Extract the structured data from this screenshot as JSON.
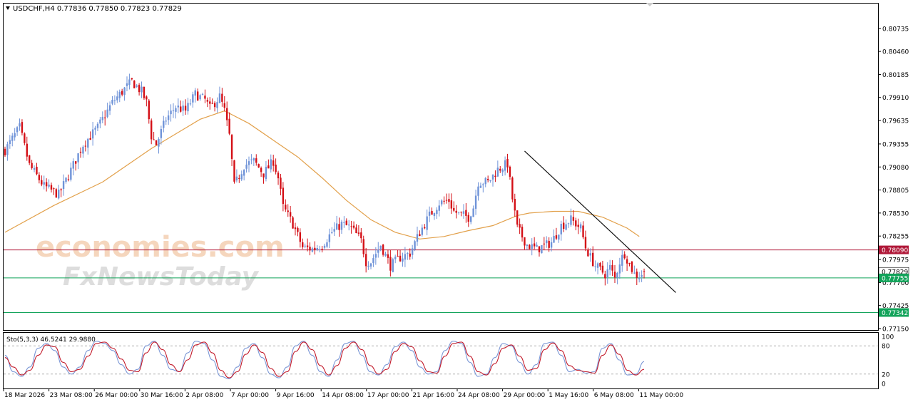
{
  "header": {
    "symbol_line": "USDCHF,H4  0.77836 0.77850 0.77823 0.77829"
  },
  "watermark": {
    "line1": "economies.com",
    "line2": "FxNewsToday"
  },
  "colors": {
    "bull": "#6f93d8",
    "bear": "#d40f16",
    "ma": "#e2a04a",
    "resistance": "#b01838",
    "support": "#12a35a",
    "trend": "#111111",
    "stoch_k": "#7b97d6",
    "stoch_d": "#c21b2b"
  },
  "chart_data": [
    {
      "type": "candlestick",
      "title": "USDCHF,H4",
      "ohlc_header": {
        "open": 0.77836,
        "high": 0.7785,
        "low": 0.77823,
        "close": 0.77829
      },
      "ylim": [
        0.7715,
        0.8081
      ],
      "y_ticks": [
        "0.80735",
        "0.80460",
        "0.80185",
        "0.79910",
        "0.79635",
        "0.79355",
        "0.79080",
        "0.78805",
        "0.78530",
        "0.78255",
        "0.77975",
        "0.77700",
        "0.77425",
        "0.77150"
      ],
      "x_ticks": [
        "18 Mar 2026",
        "23 Mar 08:00",
        "26 Mar 00:00",
        "30 Mar 16:00",
        "2 Apr 08:00",
        "7 Apr 00:00",
        "9 Apr 16:00",
        "14 Apr 08:00",
        "17 Apr 00:00",
        "21 Apr 16:00",
        "24 Apr 08:00",
        "29 Apr 00:00",
        "1 May 16:00",
        "6 May 08:00",
        "11 May 00:00"
      ],
      "close_path": [
        [
          0,
          0.7928
        ],
        [
          6,
          0.7955
        ],
        [
          10,
          0.791
        ],
        [
          16,
          0.7885
        ],
        [
          22,
          0.7875
        ],
        [
          26,
          0.7898
        ],
        [
          32,
          0.7935
        ],
        [
          38,
          0.7955
        ],
        [
          44,
          0.7985
        ],
        [
          48,
          0.7998
        ],
        [
          52,
          0.801
        ],
        [
          56,
          0.7998
        ],
        [
          58,
          0.7985
        ],
        [
          60,
          0.7945
        ],
        [
          62,
          0.7935
        ],
        [
          66,
          0.7965
        ],
        [
          70,
          0.798
        ],
        [
          74,
          0.7975
        ],
        [
          78,
          0.7995
        ],
        [
          82,
          0.7988
        ],
        [
          84,
          0.7978
        ],
        [
          88,
          0.7992
        ],
        [
          90,
          0.7975
        ],
        [
          92,
          0.7945
        ],
        [
          94,
          0.7885
        ],
        [
          98,
          0.791
        ],
        [
          102,
          0.7915
        ],
        [
          106,
          0.79
        ],
        [
          110,
          0.7915
        ],
        [
          112,
          0.7895
        ],
        [
          114,
          0.786
        ],
        [
          118,
          0.784
        ],
        [
          122,
          0.7812
        ],
        [
          126,
          0.781
        ],
        [
          130,
          0.7815
        ],
        [
          134,
          0.783
        ],
        [
          138,
          0.784
        ],
        [
          142,
          0.7835
        ],
        [
          146,
          0.782
        ],
        [
          148,
          0.7795
        ],
        [
          150,
          0.7795
        ],
        [
          154,
          0.7815
        ],
        [
          158,
          0.779
        ],
        [
          162,
          0.78
        ],
        [
          166,
          0.7805
        ],
        [
          170,
          0.783
        ],
        [
          174,
          0.785
        ],
        [
          178,
          0.7865
        ],
        [
          182,
          0.7868
        ],
        [
          184,
          0.7855
        ],
        [
          186,
          0.7852
        ],
        [
          190,
          0.7848
        ],
        [
          192,
          0.786
        ],
        [
          194,
          0.789
        ],
        [
          198,
          0.789
        ],
        [
          202,
          0.7905
        ],
        [
          206,
          0.7912
        ],
        [
          208,
          0.787
        ],
        [
          210,
          0.7835
        ],
        [
          214,
          0.7815
        ],
        [
          218,
          0.781
        ],
        [
          222,
          0.7815
        ],
        [
          224,
          0.7818
        ],
        [
          228,
          0.7838
        ],
        [
          232,
          0.7845
        ],
        [
          236,
          0.7835
        ],
        [
          238,
          0.7812
        ],
        [
          240,
          0.78
        ],
        [
          242,
          0.779
        ],
        [
          246,
          0.778
        ],
        [
          248,
          0.7788
        ],
        [
          250,
          0.7775
        ],
        [
          252,
          0.7795
        ],
        [
          254,
          0.7805
        ],
        [
          256,
          0.7792
        ],
        [
          258,
          0.778
        ],
        [
          260,
          0.7778
        ],
        [
          262,
          0.77829
        ]
      ],
      "moving_average": [
        [
          0,
          0.783
        ],
        [
          20,
          0.7862
        ],
        [
          40,
          0.789
        ],
        [
          60,
          0.793
        ],
        [
          80,
          0.7965
        ],
        [
          90,
          0.7975
        ],
        [
          100,
          0.796
        ],
        [
          110,
          0.794
        ],
        [
          120,
          0.792
        ],
        [
          130,
          0.7895
        ],
        [
          140,
          0.7868
        ],
        [
          150,
          0.7845
        ],
        [
          160,
          0.783
        ],
        [
          170,
          0.7822
        ],
        [
          180,
          0.7825
        ],
        [
          190,
          0.7832
        ],
        [
          200,
          0.7838
        ],
        [
          210,
          0.785
        ],
        [
          215,
          0.7853
        ],
        [
          225,
          0.7855
        ],
        [
          235,
          0.7855
        ],
        [
          245,
          0.7848
        ],
        [
          255,
          0.7835
        ],
        [
          260,
          0.7825
        ]
      ],
      "price_lines": [
        {
          "label": "0.78090",
          "value": 0.7809,
          "role": "resistance"
        },
        {
          "label": "0.77829",
          "value": 0.77829,
          "role": "current"
        },
        {
          "label": "0.77755",
          "value": 0.77755,
          "role": "support"
        },
        {
          "label": "0.77342",
          "value": 0.77342,
          "role": "support"
        }
      ],
      "trendline": [
        [
          213,
          0.7927
        ],
        [
          275,
          0.7758
        ]
      ]
    },
    {
      "type": "line",
      "title": "Sto(5,3,3) 46.5241 29.9880",
      "indicator": "Stochastic Oscillator",
      "k_value": 46.5241,
      "d_value": 29.988,
      "ylim": [
        0,
        100
      ],
      "y_ticks": [
        "100",
        "80",
        "20",
        "0"
      ],
      "levels": [
        80,
        20
      ],
      "series": [
        {
          "name": "K",
          "values": [
            60,
            25,
            15,
            35,
            75,
            85,
            70,
            35,
            20,
            35,
            70,
            90,
            85,
            70,
            40,
            20,
            30,
            80,
            90,
            60,
            30,
            25,
            65,
            90,
            85,
            50,
            15,
            10,
            35,
            75,
            85,
            55,
            20,
            12,
            35,
            80,
            90,
            60,
            25,
            15,
            50,
            85,
            90,
            60,
            25,
            18,
            40,
            78,
            88,
            70,
            35,
            20,
            25,
            70,
            90,
            85,
            45,
            15,
            20,
            55,
            85,
            80,
            45,
            20,
            40,
            85,
            88,
            60,
            25,
            30,
            22,
            25,
            75,
            85,
            50,
            18,
            20,
            46.5
          ]
        },
        {
          "name": "D",
          "values": [
            55,
            35,
            18,
            28,
            60,
            82,
            78,
            45,
            25,
            30,
            58,
            85,
            88,
            75,
            52,
            28,
            25,
            65,
            88,
            72,
            40,
            25,
            50,
            82,
            88,
            65,
            28,
            12,
            25,
            62,
            82,
            66,
            32,
            15,
            25,
            68,
            88,
            72,
            38,
            18,
            38,
            75,
            88,
            72,
            38,
            20,
            30,
            68,
            85,
            78,
            48,
            25,
            22,
            58,
            85,
            88,
            58,
            25,
            18,
            42,
            75,
            82,
            58,
            28,
            32,
            72,
            86,
            70,
            38,
            28,
            25,
            22,
            60,
            82,
            62,
            28,
            18,
            30
          ]
        }
      ]
    }
  ]
}
